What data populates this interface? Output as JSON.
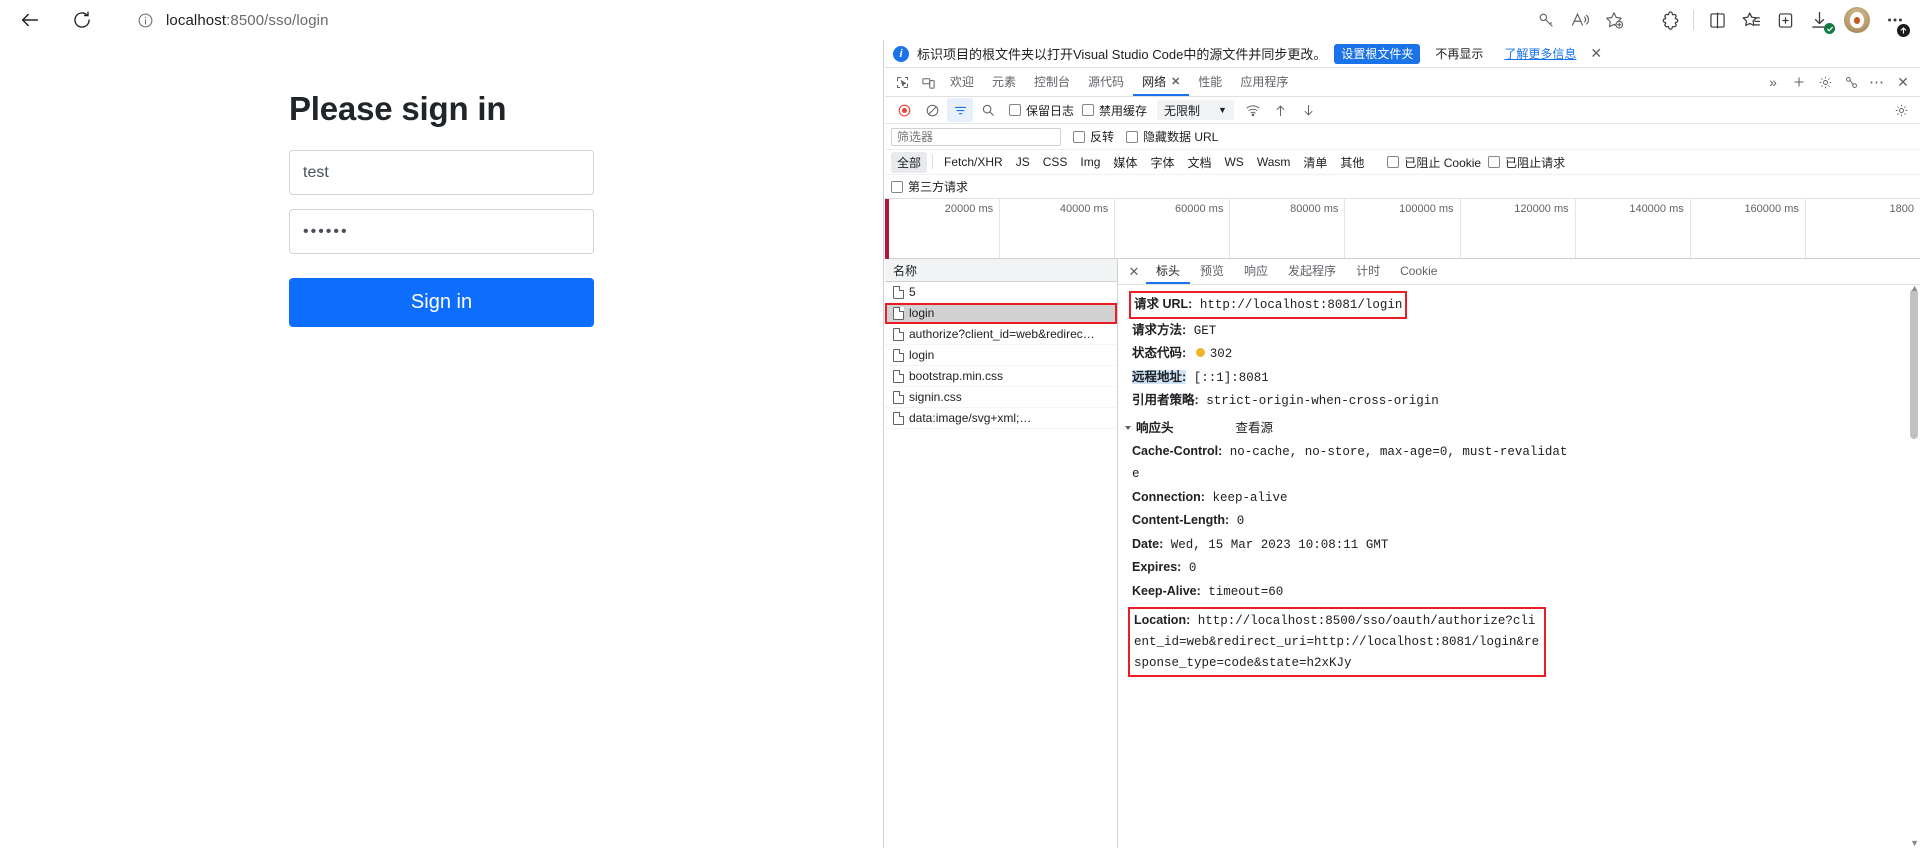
{
  "browser": {
    "back_label": "back",
    "reload_label": "reload",
    "url_host": "localhost",
    "url_path": ":8500/sso/login",
    "url_full": "localhost:8500/sso/login",
    "icons": {
      "info": "info-icon",
      "key": "key-icon",
      "read_aloud": "read-aloud-icon",
      "add_favorite": "add-favorite-icon",
      "extensions": "extensions-icon",
      "split_screen": "split-screen-icon",
      "favorites": "favorites-icon",
      "collections": "collections-icon",
      "downloads": "downloads-icon",
      "profile": "profile-avatar",
      "settings_more": "settings-and-more-icon"
    }
  },
  "page": {
    "title": "Please sign in",
    "username_value": "test",
    "username_placeholder": "",
    "password_value": "••••••",
    "password_placeholder": "",
    "signin_label": "Sign in"
  },
  "devtools": {
    "infobar": {
      "text": "标识项目的根文件夹以打开Visual Studio Code中的源文件并同步更改。",
      "primary_button": "设置根文件夹",
      "secondary_button": "不再显示",
      "link": "了解更多信息",
      "close": "✕"
    },
    "tabs": [
      {
        "label": "欢迎",
        "active": false,
        "closable": false
      },
      {
        "label": "元素",
        "active": false,
        "closable": false
      },
      {
        "label": "控制台",
        "active": false,
        "closable": false
      },
      {
        "label": "源代码",
        "active": false,
        "closable": false
      },
      {
        "label": "网络",
        "active": true,
        "closable": true,
        "close": "✕"
      },
      {
        "label": "性能",
        "active": false,
        "closable": false
      },
      {
        "label": "应用程序",
        "active": false,
        "closable": false
      }
    ],
    "tabbar_overflow": "»",
    "toolbar": {
      "record_title": "record-button",
      "clear_title": "clear-button",
      "filter_title": "filter-button",
      "search_title": "search-button",
      "preserve_log": "保留日志",
      "disable_cache": "禁用缓存",
      "throttling": "无限制",
      "throttle_caret": "▼"
    },
    "filter": {
      "placeholder": "筛选器",
      "value": "",
      "invert": "反转",
      "hide_data_urls": "隐藏数据 URL",
      "third_party": "第三方请求"
    },
    "types": [
      "全部",
      "Fetch/XHR",
      "JS",
      "CSS",
      "Img",
      "媒体",
      "字体",
      "文档",
      "WS",
      "Wasm",
      "清单",
      "其他"
    ],
    "type_active": "全部",
    "blocked_cookies": "已阻止 Cookie",
    "blocked_requests": "已阻止请求",
    "timeline_ticks": [
      "20000 ms",
      "40000 ms",
      "60000 ms",
      "80000 ms",
      "100000 ms",
      "120000 ms",
      "140000 ms",
      "160000 ms",
      "1800"
    ],
    "request_list": {
      "header": "名称",
      "rows": [
        {
          "name": "5",
          "selected": false,
          "highlighted": false
        },
        {
          "name": "login",
          "selected": true,
          "highlighted": true
        },
        {
          "name": "authorize?client_id=web&redirec…",
          "selected": false,
          "highlighted": false
        },
        {
          "name": "login",
          "selected": false,
          "highlighted": false
        },
        {
          "name": "bootstrap.min.css",
          "selected": false,
          "highlighted": false
        },
        {
          "name": "signin.css",
          "selected": false,
          "highlighted": false
        },
        {
          "name": "data:image/svg+xml;…",
          "selected": false,
          "highlighted": false
        }
      ]
    },
    "detail": {
      "close": "✕",
      "tabs": [
        {
          "label": "标头",
          "active": true
        },
        {
          "label": "预览",
          "active": false
        },
        {
          "label": "响应",
          "active": false
        },
        {
          "label": "发起程序",
          "active": false
        },
        {
          "label": "计时",
          "active": false
        },
        {
          "label": "Cookie",
          "active": false
        }
      ],
      "general": [
        {
          "key": "请求 URL:",
          "value": "http://localhost:8081/login",
          "highlight": true
        },
        {
          "key": "请求方法:",
          "value": "GET",
          "highlight": false
        },
        {
          "key": "状态代码:",
          "value": "302",
          "status_dot": true,
          "highlight": false
        },
        {
          "key": "远程地址:",
          "value": "[::1]:8081",
          "key_highlight": true,
          "highlight": false
        },
        {
          "key": "引用者策略:",
          "value": "strict-origin-when-cross-origin",
          "highlight": false
        }
      ],
      "response_headers_title": "响应头",
      "view_source": "查看源",
      "response_headers": [
        {
          "key": "Cache-Control:",
          "value": "no-cache, no-store, max-age=0, must-revalidat"
        },
        {
          "key": "",
          "value": "e"
        },
        {
          "key": "Connection:",
          "value": "keep-alive"
        },
        {
          "key": "Content-Length:",
          "value": "0"
        },
        {
          "key": "Date:",
          "value": "Wed, 15 Mar 2023 10:08:11 GMT"
        },
        {
          "key": "Expires:",
          "value": "0"
        },
        {
          "key": "Keep-Alive:",
          "value": "timeout=60"
        }
      ],
      "location_key": "Location:",
      "location_value": "http://localhost:8500/sso/oauth/authorize?client_id=web&redirect_uri=http://localhost:8081/login&response_type=code&state=h2xKJy"
    }
  },
  "colors": {
    "accent_blue": "#1a73e8",
    "button_blue": "#0d6efd",
    "highlight_red": "#ea1c24",
    "status_amber": "#f0b429"
  }
}
